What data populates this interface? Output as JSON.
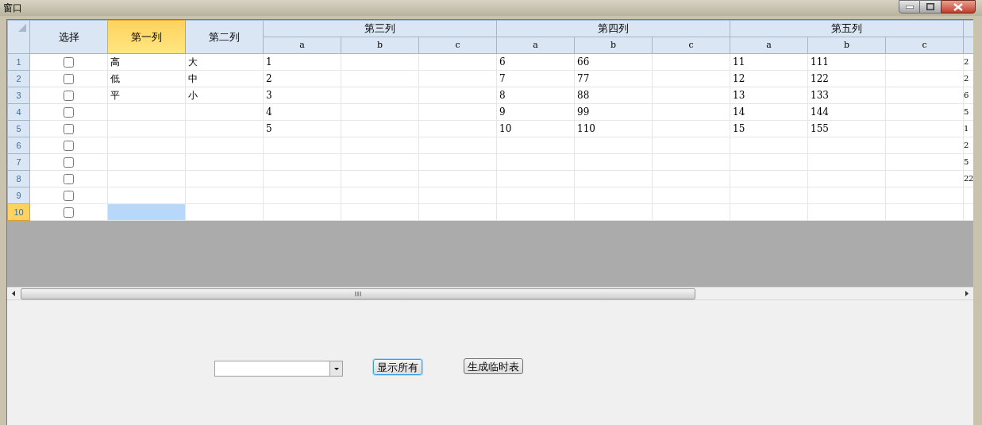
{
  "window": {
    "title": "窗口"
  },
  "grid": {
    "columns": [
      {
        "label": "选择",
        "selected": false
      },
      {
        "label": "第一列",
        "selected": true
      },
      {
        "label": "第二列",
        "selected": false
      }
    ],
    "groups": [
      {
        "label": "第三列",
        "subcolumns": [
          "a",
          "b",
          "c"
        ]
      },
      {
        "label": "第四列",
        "subcolumns": [
          "a",
          "b",
          "c"
        ]
      },
      {
        "label": "第五列",
        "subcolumns": [
          "a",
          "b",
          "c"
        ]
      }
    ],
    "rows": [
      {
        "number": "1",
        "selected": false,
        "checked": false,
        "cells": [
          "",
          "高",
          "大",
          "1",
          "",
          "",
          "6",
          "66",
          "",
          "11",
          "111",
          "",
          "2"
        ]
      },
      {
        "number": "2",
        "selected": false,
        "checked": false,
        "cells": [
          "",
          "低",
          "中",
          "2",
          "",
          "",
          "7",
          "77",
          "",
          "12",
          "122",
          "",
          "2"
        ]
      },
      {
        "number": "3",
        "selected": false,
        "checked": false,
        "cells": [
          "",
          "平",
          "小",
          "3",
          "",
          "",
          "8",
          "88",
          "",
          "13",
          "133",
          "",
          "6"
        ]
      },
      {
        "number": "4",
        "selected": false,
        "checked": false,
        "cells": [
          "",
          "",
          "",
          "4",
          "",
          "",
          "9",
          "99",
          "",
          "14",
          "144",
          "",
          "5"
        ]
      },
      {
        "number": "5",
        "selected": false,
        "checked": false,
        "cells": [
          "",
          "",
          "",
          "5",
          "",
          "",
          "10",
          "110",
          "",
          "15",
          "155",
          "",
          "1"
        ]
      },
      {
        "number": "6",
        "selected": false,
        "checked": false,
        "cells": [
          "",
          "",
          "",
          "",
          "",
          "",
          "",
          "",
          "",
          "",
          "",
          "",
          "2"
        ]
      },
      {
        "number": "7",
        "selected": false,
        "checked": false,
        "cells": [
          "",
          "",
          "",
          "",
          "",
          "",
          "",
          "",
          "",
          "",
          "",
          "",
          "5"
        ]
      },
      {
        "number": "8",
        "selected": false,
        "checked": false,
        "cells": [
          "",
          "",
          "",
          "",
          "",
          "",
          "",
          "",
          "",
          "",
          "",
          "",
          "22"
        ]
      },
      {
        "number": "9",
        "selected": false,
        "checked": false,
        "cells": [
          "",
          "",
          "",
          "",
          "",
          "",
          "",
          "",
          "",
          "",
          "",
          "",
          ""
        ]
      },
      {
        "number": "10",
        "selected": true,
        "checked": false,
        "cells": [
          "",
          "",
          "",
          "",
          "",
          "",
          "",
          "",
          "",
          "",
          "",
          "",
          ""
        ]
      }
    ]
  },
  "buttons": [
    {
      "label": "显示所有",
      "focused": true
    },
    {
      "label": "生成临时表",
      "focused": false
    }
  ]
}
